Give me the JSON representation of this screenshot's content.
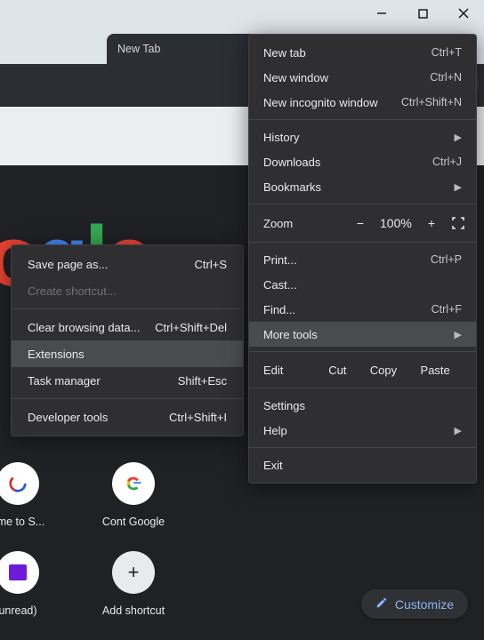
{
  "window": {
    "tab_title": "New Tab"
  },
  "toolbar": {
    "star_color": "#4a7fe8",
    "wave_color": "#33bff3"
  },
  "logo": {
    "o1": "o",
    "o2": "o",
    "g": "g",
    "l": "l",
    "e": "e"
  },
  "shortcuts": {
    "row1": [
      {
        "label": "ome to S..."
      },
      {
        "label": "Cont Google"
      }
    ],
    "row2": [
      {
        "label": "unread)"
      },
      {
        "label": "Add shortcut"
      }
    ]
  },
  "customize": {
    "label": "Customize"
  },
  "menu": {
    "new_tab": {
      "label": "New tab",
      "key": "Ctrl+T"
    },
    "new_window": {
      "label": "New window",
      "key": "Ctrl+N"
    },
    "new_incognito": {
      "label": "New incognito window",
      "key": "Ctrl+Shift+N"
    },
    "history": {
      "label": "History"
    },
    "downloads": {
      "label": "Downloads",
      "key": "Ctrl+J"
    },
    "bookmarks": {
      "label": "Bookmarks"
    },
    "zoom": {
      "label": "Zoom",
      "minus": "−",
      "value": "100%",
      "plus": "+"
    },
    "print": {
      "label": "Print...",
      "key": "Ctrl+P"
    },
    "cast": {
      "label": "Cast..."
    },
    "find": {
      "label": "Find...",
      "key": "Ctrl+F"
    },
    "more_tools": {
      "label": "More tools"
    },
    "edit": {
      "label": "Edit",
      "cut": "Cut",
      "copy": "Copy",
      "paste": "Paste"
    },
    "settings": {
      "label": "Settings"
    },
    "help": {
      "label": "Help"
    },
    "exit": {
      "label": "Exit"
    }
  },
  "submenu": {
    "save_page": {
      "label": "Save page as...",
      "key": "Ctrl+S"
    },
    "create_shortcut": {
      "label": "Create shortcut..."
    },
    "clear_data": {
      "label": "Clear browsing data...",
      "key": "Ctrl+Shift+Del"
    },
    "extensions": {
      "label": "Extensions"
    },
    "task_manager": {
      "label": "Task manager",
      "key": "Shift+Esc"
    },
    "devtools": {
      "label": "Developer tools",
      "key": "Ctrl+Shift+I"
    }
  }
}
